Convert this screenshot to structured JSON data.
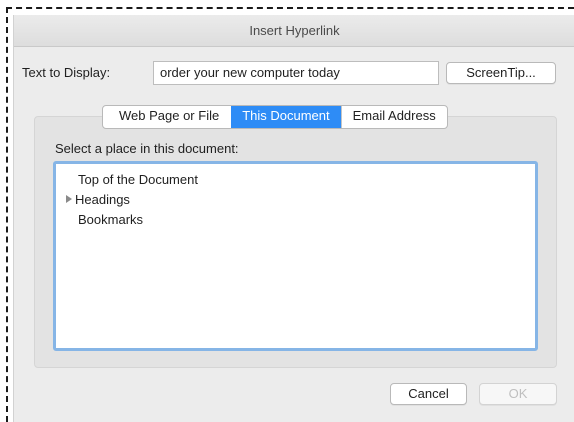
{
  "dialog": {
    "title": "Insert Hyperlink",
    "text_to_display_label": "Text to Display:",
    "text_to_display_value": "order your new computer today",
    "screentip_label": "ScreenTip...",
    "tabs": [
      {
        "label": "Web Page or File",
        "active": false
      },
      {
        "label": "This Document",
        "active": true
      },
      {
        "label": "Email Address",
        "active": false
      }
    ],
    "place_label": "Select a place in this document:",
    "places": [
      {
        "label": "Top of the Document",
        "expandable": false
      },
      {
        "label": "Headings",
        "expandable": true,
        "icon": "disclosure-triangle-icon"
      },
      {
        "label": "Bookmarks",
        "expandable": false
      }
    ],
    "cancel_label": "Cancel",
    "ok_label": "OK",
    "ok_enabled": false
  },
  "colors": {
    "accent": "#2e8cf6",
    "focus_ring": "#86b5e6",
    "dialog_background": "#ececec"
  }
}
